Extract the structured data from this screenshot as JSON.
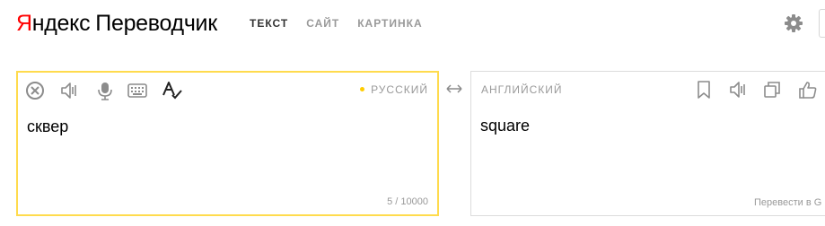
{
  "header": {
    "logo": {
      "brand_first": "Я",
      "brand_rest": "ндекс",
      "product": "Переводчик"
    },
    "tabs": [
      {
        "label": "ТЕКСТ",
        "active": true
      },
      {
        "label": "САЙТ",
        "active": false
      },
      {
        "label": "КАРТИНКА",
        "active": false
      }
    ],
    "settings_icon": "gear-icon"
  },
  "source": {
    "language": "РУССКИЙ",
    "text": "сквер",
    "counter": "5 / 10000",
    "toolbar_icons": [
      "clear-icon",
      "speaker-icon",
      "microphone-icon",
      "keyboard-icon",
      "spellcheck-icon"
    ]
  },
  "swap_icon": "swap-arrows-icon",
  "target": {
    "language": "АНГЛИЙСКИЙ",
    "text": "square",
    "footer_link": "Перевести в G",
    "toolbar_icons": [
      "bookmark-icon",
      "speaker-icon",
      "copy-icon",
      "thumbs-up-icon"
    ]
  },
  "colors": {
    "accent": "#ffdb4d",
    "brand_red": "#ff0000",
    "muted_text": "#999999",
    "icon_gray": "#8c8c8c",
    "border": "#dcdcdc"
  }
}
